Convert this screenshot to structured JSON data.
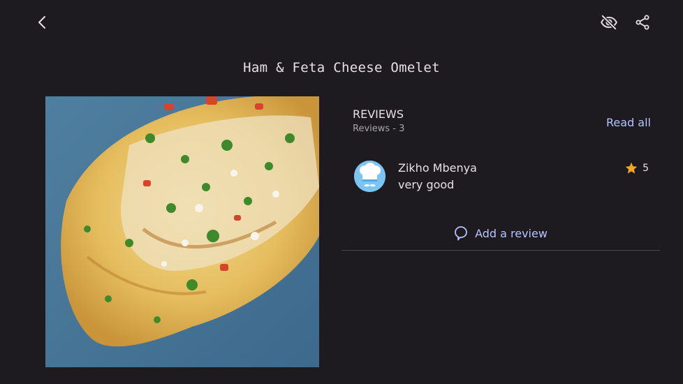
{
  "recipe": {
    "title": "Ham & Feta Cheese Omelet"
  },
  "icons": {
    "back": "arrow-back-icon",
    "hide": "visibility-off-icon",
    "share": "share-icon",
    "rating": "star-icon",
    "add_review": "chat-bubble-icon"
  },
  "reviews": {
    "heading": "REVIEWS",
    "count_label": "Reviews - 3",
    "read_all_label": "Read all",
    "items": [
      {
        "author": "Zikho Mbenya",
        "text": "very good",
        "rating": "5"
      }
    ],
    "add_review_label": "Add a review"
  },
  "colors": {
    "background": "#1d1b20",
    "accent": "#b5c4ff",
    "star": "#f5a623",
    "avatar_bg": "#7cc4f2"
  }
}
